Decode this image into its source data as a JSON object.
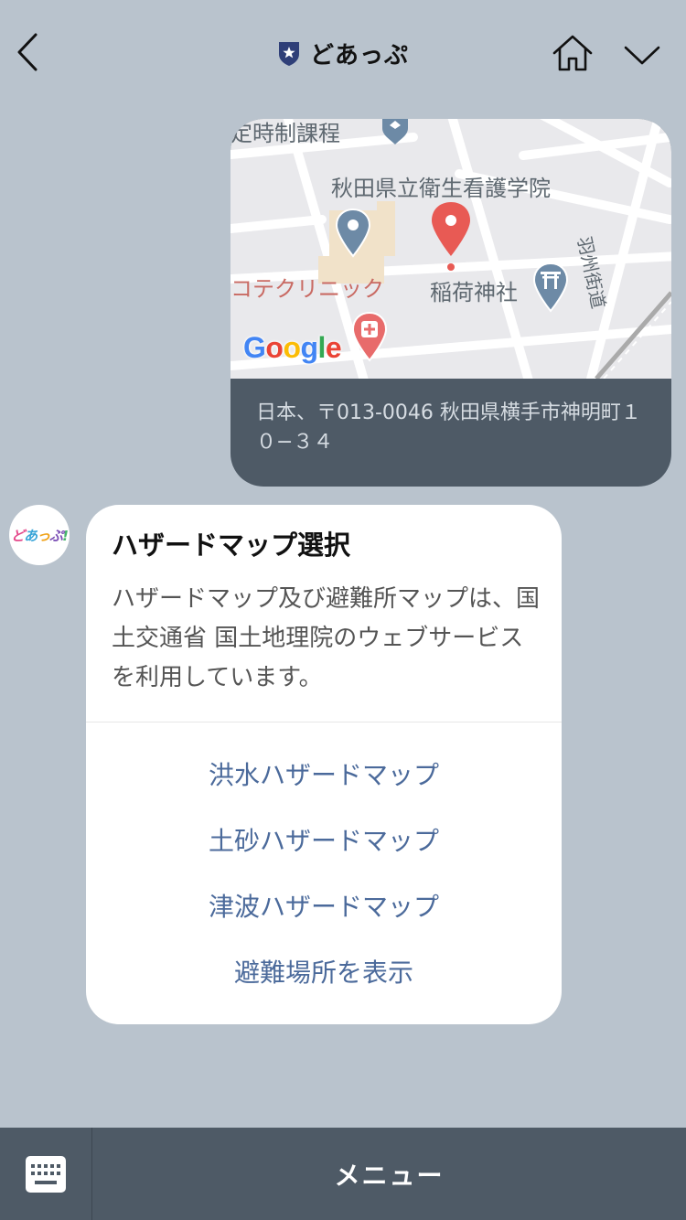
{
  "header": {
    "title": "どあっぷ",
    "back_icon": "chevron-left-icon",
    "badge_icon": "star-shield-icon",
    "home_icon": "home-icon",
    "collapse_icon": "chevron-down-icon"
  },
  "location_message": {
    "map_labels": {
      "school_top": "定時制課程",
      "nursing_school": "秋田県立衛生看護学院",
      "clinic": "コテクリニック",
      "shrine": "稲荷神社",
      "road": "羽州街道"
    },
    "map_brand": "Google",
    "address": "日本、〒013-0046 秋田県横手市神明町１０−３４"
  },
  "bot_avatar": {
    "text": "どあっぷ!"
  },
  "card": {
    "title": "ハザードマップ選択",
    "description": "ハザードマップ及び避難所マップは、国土交通省 国土地理院のウェブサービスを利用しています。",
    "actions": [
      {
        "label": "洪水ハザードマップ"
      },
      {
        "label": "土砂ハザードマップ"
      },
      {
        "label": "津波ハザードマップ"
      },
      {
        "label": "避難場所を表示"
      }
    ]
  },
  "bottom_bar": {
    "keyboard_icon": "keyboard-icon",
    "menu_label": "メニュー"
  },
  "colors": {
    "background": "#b9c3cd",
    "bar": "#4e5a66",
    "action_link": "#4b6a9b",
    "pin_red": "#e85a54"
  }
}
